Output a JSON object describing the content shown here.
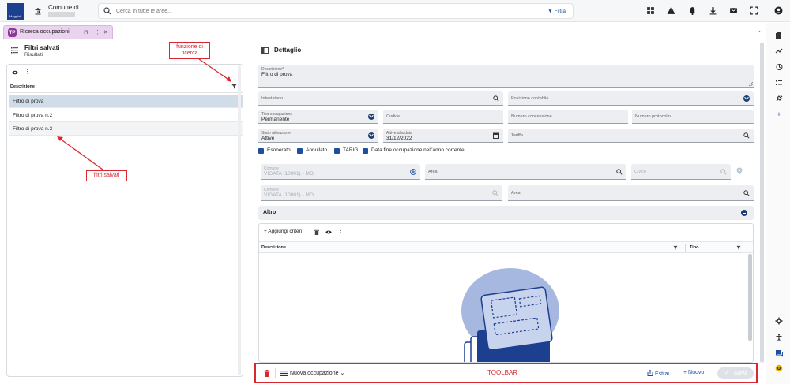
{
  "header": {
    "logo_text": "Maggioli",
    "municipality_label": "Comune di",
    "search": {
      "placeholder": "Cerca in tutte le aree...",
      "filter_label": "Filtra"
    },
    "icons": [
      "grid-icon",
      "warning-icon",
      "bell-icon",
      "download-icon",
      "mail-icon",
      "fullscreen-icon",
      "user-icon"
    ]
  },
  "tab": {
    "icon_text": "TP",
    "label": "Ricerca occupazioni"
  },
  "left": {
    "title": "Filtri salvati",
    "subtitle": "Risultati",
    "column_header": "Descrizione",
    "rows": [
      "Filtro di prova",
      "Filtro di prova n.2",
      "Filtro di prova n.3"
    ]
  },
  "annotations": {
    "search_function": "funzione di ricerca",
    "saved_filters": "filtri salvati",
    "toolbar": "TOOLBAR"
  },
  "detail": {
    "title": "Dettaglio",
    "descrizione_label": "Descrizione",
    "descrizione_value": "Filtro di prova",
    "intestatario": "Intestatario",
    "posizione_contabile": "Posizione contabile",
    "tipo_occupazione_label": "Tipo occupazione",
    "tipo_occupazione_value": "Permanente",
    "codice": "Codice",
    "numero_concessione": "Numero concessione",
    "numero_protocollo": "Numero protocollo",
    "stato_attivazione_label": "Stato attivazione",
    "stato_attivazione_value": "Attive",
    "attive_alla_data_label": "Attive alla data",
    "attive_alla_data_value": "31/12/2022",
    "tariffa": "Tariffa",
    "checkboxes": [
      "Esonerato",
      "Annullato",
      "TARIG",
      "Data fine occupazione nell'anno corrente"
    ],
    "comune1_label": "Comune",
    "comune1_value": "VIGATA (10001) - MO",
    "area1": "Area",
    "civico": "Civico",
    "comune2_label": "Comune",
    "comune2_value": "VIGATA (10001) - MO",
    "area2": "Area",
    "altro": "Altro",
    "criteria": {
      "add_label": "+ Aggiungi criteri",
      "col_descrizione": "Descrizione",
      "col_tipo": "Tipo"
    }
  },
  "toolbar": {
    "new_occupation": "Nuova occupazione",
    "estrai": "Estrai",
    "nuovo": "+ Nuovo",
    "salva": "Salva"
  },
  "colors": {
    "primary": "#1d4ea0",
    "annotation_red": "#d9282f",
    "selected_row": "#d0dde9",
    "tab_bg": "#ead3ef"
  }
}
